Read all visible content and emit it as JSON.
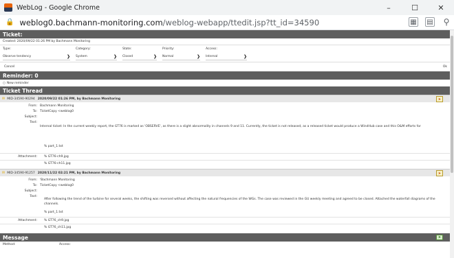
{
  "window": {
    "title": "WebLog - Google Chrome",
    "minimize": "–",
    "maximize": "☐",
    "close": "✕"
  },
  "urlbar": {
    "host": "weblog0.bachmann-monitoring.com",
    "path": "/weblog-webapp/ttedit.jsp?tt_id=34590"
  },
  "ticket": {
    "header": "Ticket:",
    "created": "Created: 2020/09/22 01:26 PM by Bachmann Monitoring",
    "fields": [
      {
        "label": "Type:",
        "value": "Observe tendency"
      },
      {
        "label": "Category:",
        "value": "System"
      },
      {
        "label": "State:",
        "value": "Closed"
      },
      {
        "label": "Priority:",
        "value": "Normal"
      },
      {
        "label": "Access:",
        "value": "Internal"
      }
    ],
    "cancel_label": "Cancel",
    "ok_label": "Ok"
  },
  "reminder": {
    "header": "Reminder: 0",
    "new_label": "New reminder"
  },
  "thread": {
    "header": "Ticket Thread",
    "messages": [
      {
        "id": "MID-34590-90294",
        "heading": "2020/09/22 01:26 PM, by Bachmann Monitoring",
        "from": "Bachmann Monitoring",
        "to": "TicketCopy <weblog0",
        "subject": "",
        "text": "Internal ticket: In the current weekly report, the GT76 is marked as 'OBSERVE', as there is a slight abnormality in channels 9 and 11. Currently, the ticket is not released, as a released ticket would produce a WindHub case and this O&M efforts for",
        "file": "% part_1.txt",
        "attachments": [
          "% GT76-ch9.jpg",
          "% GT76-ch11.jpg"
        ]
      },
      {
        "id": "MID-34590-91257",
        "heading": "2020/11/22 02:21 PM, by Bachmann Monitoring",
        "from": "'Bachmann Monitoring",
        "to": "TicketCopy <weblog0",
        "subject": "",
        "text": "After following the trend of the turbine for several weeks, the shifting was reversed without affecting the natural frequencies of the WGs. The case was reviewed in the          GU weekly meeting and agreed to be closed.  Attached the waterfall diagrams of the channels.",
        "file": "% part_1.txt",
        "attachments": [
          "% GT76_ch9.jpg",
          "% GT76_ch11.jpg"
        ]
      }
    ]
  },
  "labels": {
    "from": "From:",
    "to": "To:",
    "subject": "Subject:",
    "text": "Text:",
    "attachment": "Attachment:"
  },
  "message": {
    "header": "Message",
    "sub_left": "Method:",
    "sub_right": "Access:"
  }
}
